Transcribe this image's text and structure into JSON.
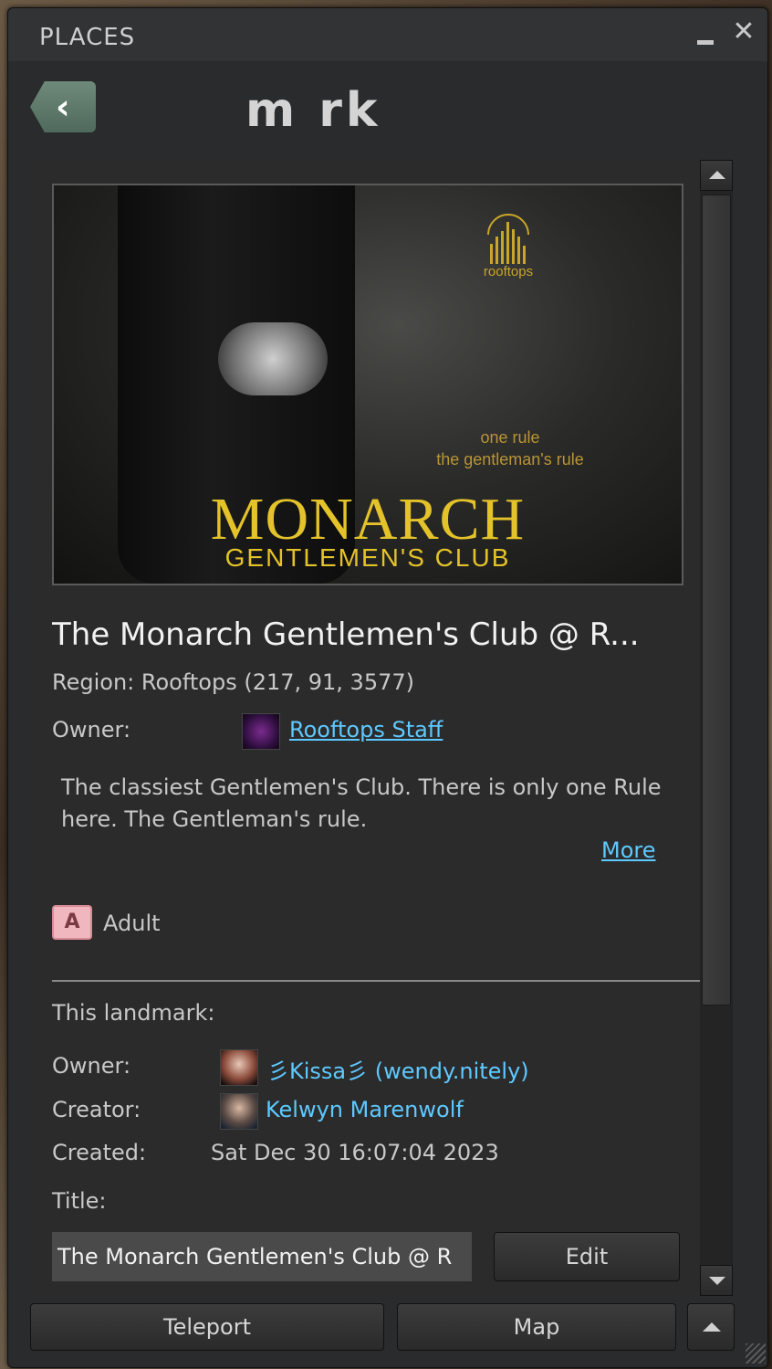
{
  "window": {
    "title": "PLACES",
    "header_title": "m   rk"
  },
  "hero": {
    "logo_text": "rooftops",
    "tagline_1": "one rule",
    "tagline_2": "the gentleman's rule",
    "brand": "MONARCH",
    "brand_sub": "GENTLEMEN'S CLUB"
  },
  "place": {
    "name": "The Monarch Gentlemen's Club @ R...",
    "region": "Region: Rooftops (217, 91, 3577)",
    "owner_label": "Owner:",
    "owner_name": "Rooftops Staff",
    "description": "The classiest Gentlemen's Club. There is only one Rule here. The Gentleman's rule.",
    "more_label": "More",
    "maturity_icon": "A",
    "maturity_label": "Adult"
  },
  "landmark": {
    "section_label": "This landmark:",
    "owner_label": "Owner:",
    "owner_name": "彡Kissa彡 (wendy.nitely)",
    "creator_label": "Creator:",
    "creator_name": "Kelwyn Marenwolf",
    "created_label": "Created:",
    "created_value": "Sat Dec 30 16:07:04 2023",
    "title_label": "Title:",
    "title_value": "The Monarch Gentlemen's Club @ R",
    "edit_label": "Edit"
  },
  "footer": {
    "teleport_label": "Teleport",
    "map_label": "Map"
  },
  "icons": {
    "close": "close-icon",
    "minimize": "minimize-icon",
    "back": "back-arrow-icon",
    "scroll_up": "arrow-up-icon",
    "scroll_down": "arrow-down-icon",
    "more": "arrow-up-icon"
  },
  "colors": {
    "link": "#5ec9ff",
    "panel_bg": "#2b2b2b",
    "brand_gold": "#e3c22a",
    "adult_badge": "#f0b7be"
  }
}
